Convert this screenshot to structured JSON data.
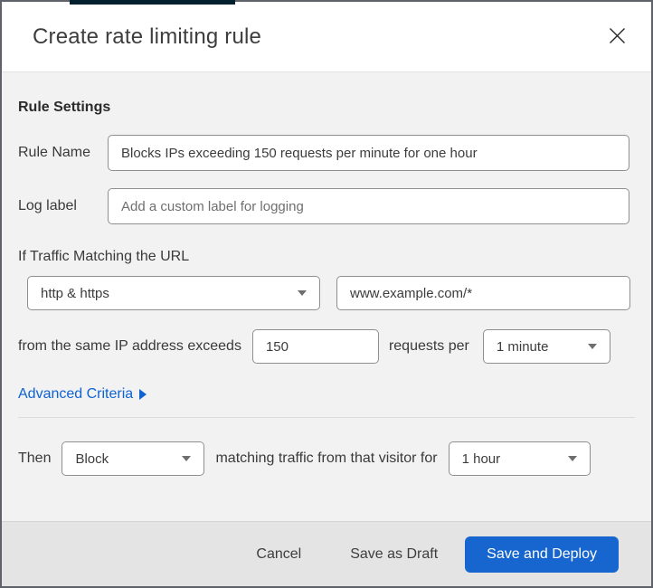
{
  "modal": {
    "title": "Create rate limiting rule"
  },
  "form": {
    "section_heading": "Rule Settings",
    "rule_name": {
      "label": "Rule Name",
      "value": "Blocks IPs exceeding 150 requests per minute for one hour"
    },
    "log_label": {
      "label": "Log label",
      "placeholder": "Add a custom label for logging"
    },
    "traffic_match": {
      "heading": "If Traffic Matching the URL",
      "scheme_selected": "http & https",
      "url_value": "www.example.com/*"
    },
    "threshold": {
      "prefix": "from the same IP address exceeds",
      "count_value": "150",
      "middle": "requests per",
      "period_selected": "1 minute"
    },
    "advanced_criteria_label": "Advanced Criteria",
    "action": {
      "prefix": "Then",
      "action_selected": "Block",
      "middle": "matching traffic from that visitor for",
      "duration_selected": "1 hour"
    }
  },
  "footer": {
    "cancel_label": "Cancel",
    "save_draft_label": "Save as Draft",
    "save_deploy_label": "Save and Deploy"
  },
  "colors": {
    "accent_blue": "#1766d0",
    "link_blue": "#0e62d4",
    "body_bg": "#f2f2f2",
    "footer_bg": "#e4e4e4",
    "top_strip": "#03202f"
  }
}
